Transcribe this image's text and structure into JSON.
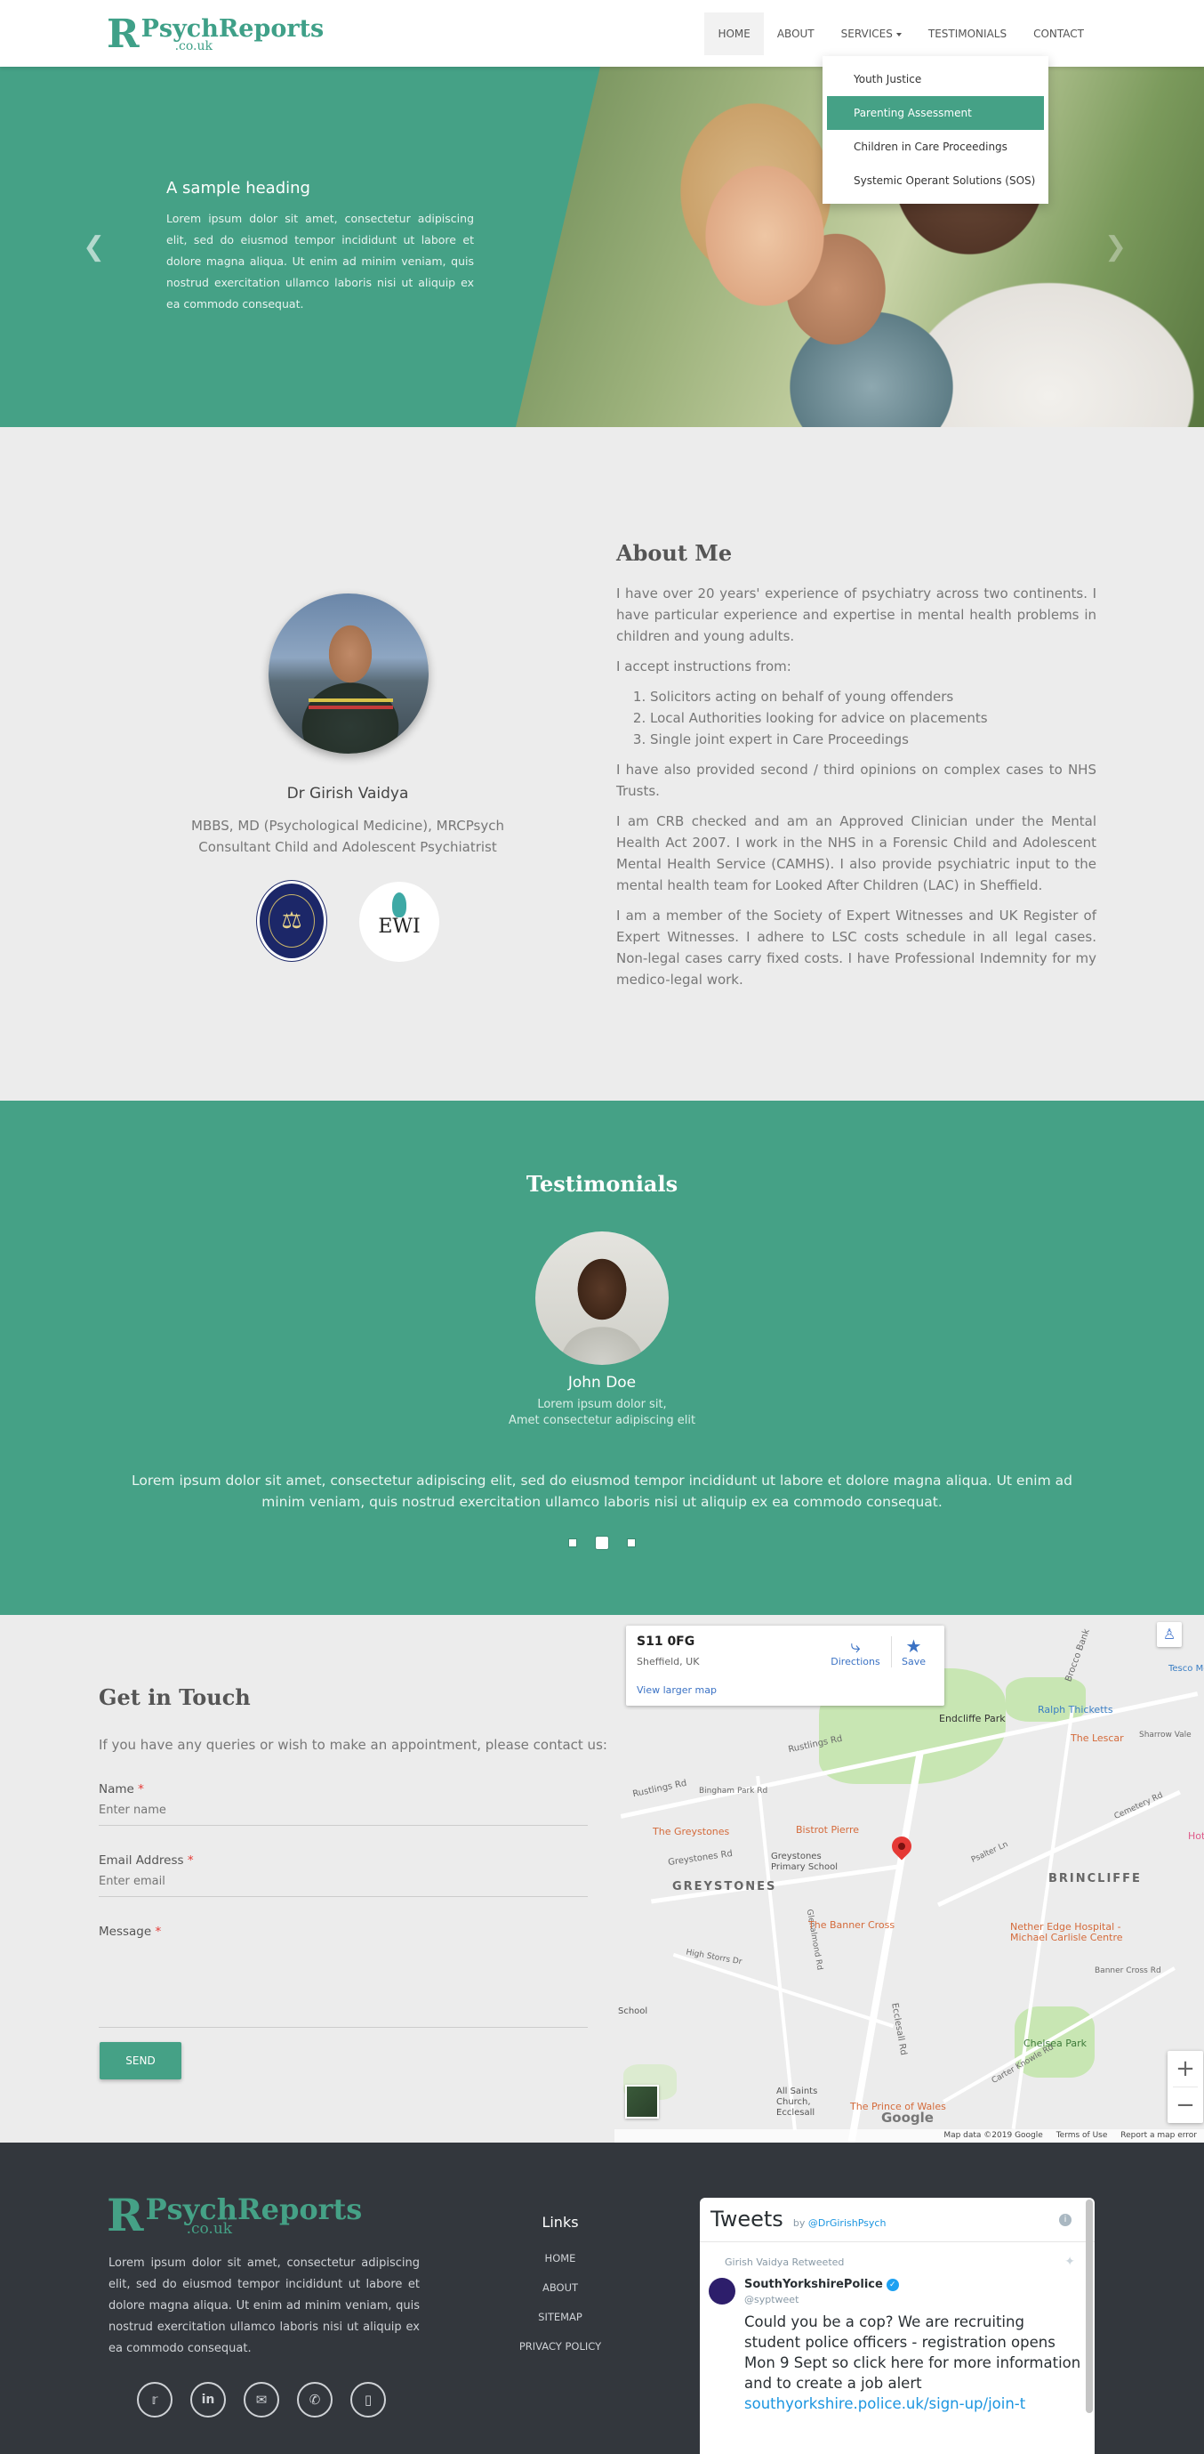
{
  "nav": {
    "logo_mark": "R",
    "logo_word": "PsychReports",
    "logo_sub": ".co.uk",
    "items": [
      {
        "label": "HOME"
      },
      {
        "label": "ABOUT"
      },
      {
        "label": "SERVICES"
      },
      {
        "label": "TESTIMONIALS"
      },
      {
        "label": "CONTACT"
      }
    ],
    "dropdown": [
      {
        "label": "Youth Justice"
      },
      {
        "label": "Parenting Assessment"
      },
      {
        "label": "Children in Care Proceedings"
      },
      {
        "label": "Systemic Operant Solutions (SOS)"
      }
    ]
  },
  "hero": {
    "heading": "A sample heading",
    "text": "Lorem ipsum dolor sit amet, consectetur adipiscing elit, sed do eiusmod tempor incididunt ut labore et dolore magna aliqua. Ut enim ad minim veniam, quis nostrud exercitation ullamco laboris nisi ut aliquip ex ea commodo consequat.",
    "prev_icon": "chevron-left-icon",
    "next_icon": "chevron-right-icon"
  },
  "about": {
    "name": "Dr Girish Vaidya",
    "qualifications": "MBBS, MD (Psychological Medicine), MRCPsych",
    "role": "Consultant Child and Adolescent Psychiatrist",
    "badge2_text": "EWI",
    "title": "About Me",
    "p1": "I have over 20 years' experience of psychiatry across two continents. I have particular experience and expertise in mental health problems in children and young adults.",
    "p2": "I accept instructions from:",
    "list": [
      "Solicitors acting on behalf of young offenders",
      "Local Authorities looking for advice on placements",
      "Single joint expert in Care Proceedings"
    ],
    "p3": "I have also provided second / third opinions on complex cases to NHS Trusts.",
    "p4": "I am CRB checked and am an Approved Clinician under the Mental Health Act 2007. I work in the NHS in a Forensic Child and Adolescent Mental Health Service (CAMHS). I also provide psychiatric input to the mental health team for Looked After Children (LAC) in Sheffield.",
    "p5": "I am a member of the Society of Expert Witnesses and UK Register of Expert Witnesses. I adhere to LSC costs schedule in all legal cases. Non-legal cases carry fixed costs. I have Professional Indemnity for my medico-legal work."
  },
  "testimonials": {
    "title": "Testimonials",
    "name": "John Doe",
    "role1": "Lorem ipsum dolor sit,",
    "role2": "Amet consectetur adipiscing elit",
    "quote": "Lorem ipsum dolor sit amet, consectetur adipiscing elit, sed do eiusmod tempor incididunt ut labore et dolore magna aliqua. Ut enim ad minim veniam, quis nostrud exercitation ullamco laboris nisi ut aliquip ex ea commodo consequat.",
    "active_slide": 2,
    "slide_count": 3
  },
  "contact": {
    "title": "Get in Touch",
    "intro": "If you have any queries or wish to make an appointment, please contact us:",
    "name_label": "Name",
    "name_placeholder": "Enter name",
    "email_label": "Email Address",
    "email_placeholder": "Enter email",
    "message_label": "Message",
    "required_mark": "*",
    "send_label": "SEND"
  },
  "map": {
    "card_title": "S11 0FG",
    "card_sub": "Sheffield, UK",
    "view_larger": "View larger map",
    "directions": "Directions",
    "save": "Save",
    "areas": [
      "GREYSTONES",
      "BRINCLIFFE"
    ],
    "parks": [
      "Endcliffe Park",
      "Chelsea Park"
    ],
    "pois": [
      "Ralph Thicketts",
      "The Lescar",
      "The Greystones",
      "Bistrot Pierre",
      "The Banner Cross",
      "Nether Edge Hospital - Michael Carlisle Centre",
      "The Prince of Wales",
      "All Saints Church, Ecclesall",
      "Greystones Primary School",
      "Tesco Me",
      "Hotel",
      "School"
    ],
    "roads": [
      "Rustlings Rd",
      "Ecclesall Rd",
      "Greystones Rd",
      "Brocco Bank",
      "Rustlings Rd",
      "Bingham Park Rd",
      "Sharrow Vale",
      "Psalter Ln",
      "High Storrs Dr",
      "Carter Knowle Rd",
      "Cemetery Rd",
      "Glenalmond Rd",
      "Banner Cross Rd"
    ],
    "footer_data": "Map data ©2019 Google",
    "footer_terms": "Terms of Use",
    "footer_report": "Report a map error",
    "google": "Google"
  },
  "footer": {
    "logo_mark": "R",
    "logo_word": "PsychReports",
    "logo_sub": ".co.uk",
    "text": "Lorem ipsum dolor sit amet, consectetur adipiscing elit, sed do eiusmod tempor incididunt ut labore et dolore magna aliqua. Ut enim ad minim veniam, quis nostrud exercitation ullamco laboris nisi ut aliquip ex ea commodo consequat.",
    "links_title": "Links",
    "links": [
      {
        "label": "HOME"
      },
      {
        "label": "ABOUT"
      },
      {
        "label": "SITEMAP"
      },
      {
        "label": "PRIVACY POLICY"
      }
    ],
    "social_icons": [
      "twitter-icon",
      "linkedin-icon",
      "email-icon",
      "phone-icon",
      "mobile-icon"
    ]
  },
  "twitter": {
    "title": "Tweets",
    "by": "by",
    "handle": "@DrGirishPsych",
    "retweeted": "Girish Vaidya Retweeted",
    "user": "SouthYorkshirePolice",
    "user_handle": "@syptweet",
    "text": "Could you be a cop? We are recruiting student police officers - registration opens Mon 9 Sept so click here for more information and to create a job alert",
    "link": "southyorkshire.police.uk/sign-up/join-t"
  }
}
